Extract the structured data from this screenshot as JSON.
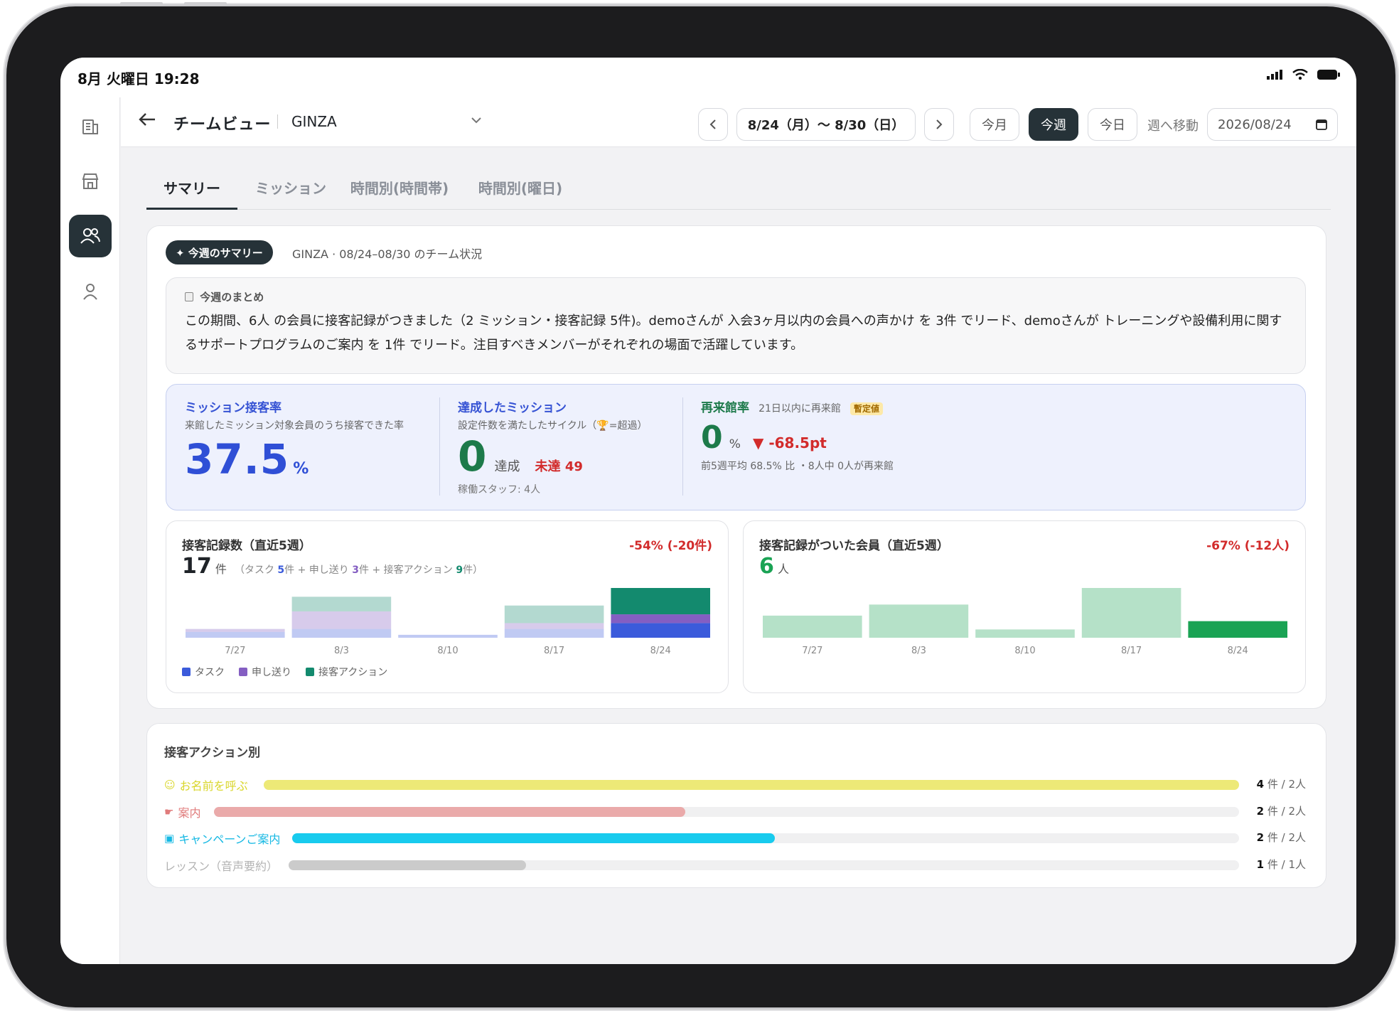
{
  "status": {
    "time": "8月 火曜日 19:28"
  },
  "header": {
    "title": "チームビュー",
    "store": "GINZA",
    "date_range": "8/24（月）〜 8/30（日）",
    "month_btn": "今月",
    "week_btn": "今週",
    "today_btn": "今日",
    "jump_label": "週へ移動",
    "date_value": "2026/08/24"
  },
  "tabs": [
    "サマリー",
    "ミッション",
    "時間別(時間帯)",
    "時間別(曜日)"
  ],
  "summary": {
    "badge": "✦ 今週のサマリー",
    "context": "GINZA · 08/24–08/30 のチーム状況",
    "box_label": "今週のまとめ",
    "text": "この期間、6人 の会員に接客記録がつきました（2 ミッション・接客記録 5件)。demoさんが 入会3ヶ月以内の会員への声かけ を 3件 でリード、demoさんが トレーニングや設備利用に関するサポートプログラムのご案内 を 1件 でリード。注目すべきメンバーがそれぞれの場面で活躍しています。"
  },
  "kpis": {
    "rate": {
      "title": "ミッション接客率",
      "sub": "来館したミッション対象会員のうち接客できた率",
      "value": "37.5",
      "unit": "%"
    },
    "missions": {
      "title": "達成したミッション",
      "sub": "設定件数を満たしたサイクル（🏆=超過）",
      "value": "0",
      "unit": "達成",
      "miss_label": "未達 49",
      "footer": "稼働スタッフ: 4人"
    },
    "revisit": {
      "title": "再来館率",
      "hint": "21日以内に再来館",
      "badge": "暫定値",
      "value": "0",
      "unit": "%",
      "delta": "▼ -68.5pt",
      "footer": "前5週平均 68.5% 比 ・8人中 0人が再来館"
    }
  },
  "records_chart": {
    "title": "接客記録数（直近5週）",
    "change": "-54% (-20件)",
    "total": "17",
    "total_unit": "件",
    "bd_open": "（タスク",
    "bd_task": "5",
    "bd_mid1": "件 + 申し送り",
    "bd_handover": "3",
    "bd_mid2": "件 + 接客アクション",
    "bd_action": "9",
    "bd_close": "件）",
    "legend": {
      "task": "タスク",
      "handover": "申し送り",
      "action": "接客アクション"
    }
  },
  "members_chart": {
    "title": "接客記録がついた会員（直近5週）",
    "change": "-67% (-12人)",
    "total": "6",
    "total_unit": "人"
  },
  "chart_data": [
    {
      "type": "bar",
      "stacked": true,
      "categories": [
        "7/27",
        "8/3",
        "8/10",
        "8/17",
        "8/24"
      ],
      "series": [
        {
          "name": "タスク",
          "values": [
            2,
            3,
            1,
            3,
            5
          ],
          "color": "#3b5bdb"
        },
        {
          "name": "申し送り",
          "values": [
            1,
            6,
            0,
            2,
            3
          ],
          "color": "#845ec2"
        },
        {
          "name": "接客アクション",
          "values": [
            0,
            5,
            0,
            6,
            9
          ],
          "color": "#138a6e"
        }
      ]
    },
    {
      "type": "bar",
      "categories": [
        "7/27",
        "8/3",
        "8/10",
        "8/17",
        "8/24"
      ],
      "values": [
        8,
        12,
        3,
        18,
        6
      ],
      "color": "#1aa354"
    }
  ],
  "actions": {
    "title": "接客アクション別",
    "items": [
      {
        "label": "お名前を呼ぶ",
        "icon": "smile-icon",
        "glyph": "☺",
        "color": "#d9d62a",
        "bar": "#ede977",
        "value": 4,
        "max": 4,
        "count": "4",
        "unit": "件",
        "people": "/ 2人"
      },
      {
        "label": "案内",
        "icon": "hand-icon",
        "glyph": "☛",
        "color": "#e07b7b",
        "bar": "#eaaaaa",
        "value": 2,
        "max": 4,
        "count": "2",
        "unit": "件",
        "people": "/ 2人"
      },
      {
        "label": "キャンペーンご案内",
        "icon": "calendar-icon",
        "glyph": "▣",
        "color": "#15b8e3",
        "bar": "#18cbee",
        "value": 2,
        "max": 4,
        "count": "2",
        "unit": "件",
        "people": "/ 2人"
      },
      {
        "label": "レッスン（音声要約）",
        "icon": "",
        "glyph": "",
        "color": "#b3b3b3",
        "bar": "#cbcbcb",
        "value": 1,
        "max": 4,
        "count": "1",
        "unit": "件",
        "people": "/ 1人"
      }
    ]
  }
}
